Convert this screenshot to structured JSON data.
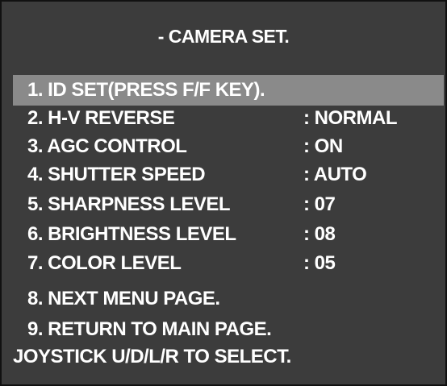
{
  "menu": {
    "title": "- CAMERA SET.",
    "items": [
      {
        "label": "1. ID SET(PRESS F/F KEY).",
        "value": ""
      },
      {
        "label": "2. H-V REVERSE",
        "value": ": NORMAL"
      },
      {
        "label": "3. AGC CONTROL",
        "value": ": ON"
      },
      {
        "label": "4. SHUTTER SPEED",
        "value": ": AUTO"
      },
      {
        "label": "5. SHARPNESS LEVEL",
        "value": ": 07"
      },
      {
        "label": "6. BRIGHTNESS LEVEL",
        "value": ": 08"
      },
      {
        "label": "7. COLOR LEVEL",
        "value": ": 05"
      },
      {
        "label": "8. NEXT MENU PAGE.",
        "value": ""
      },
      {
        "label": "9. RETURN TO MAIN PAGE.",
        "value": ""
      }
    ],
    "footer": "JOYSTICK U/D/L/R TO SELECT."
  },
  "colors": {
    "background": "#3c3c3c",
    "highlight": "#8a8a8a",
    "text": "#ffffff"
  }
}
